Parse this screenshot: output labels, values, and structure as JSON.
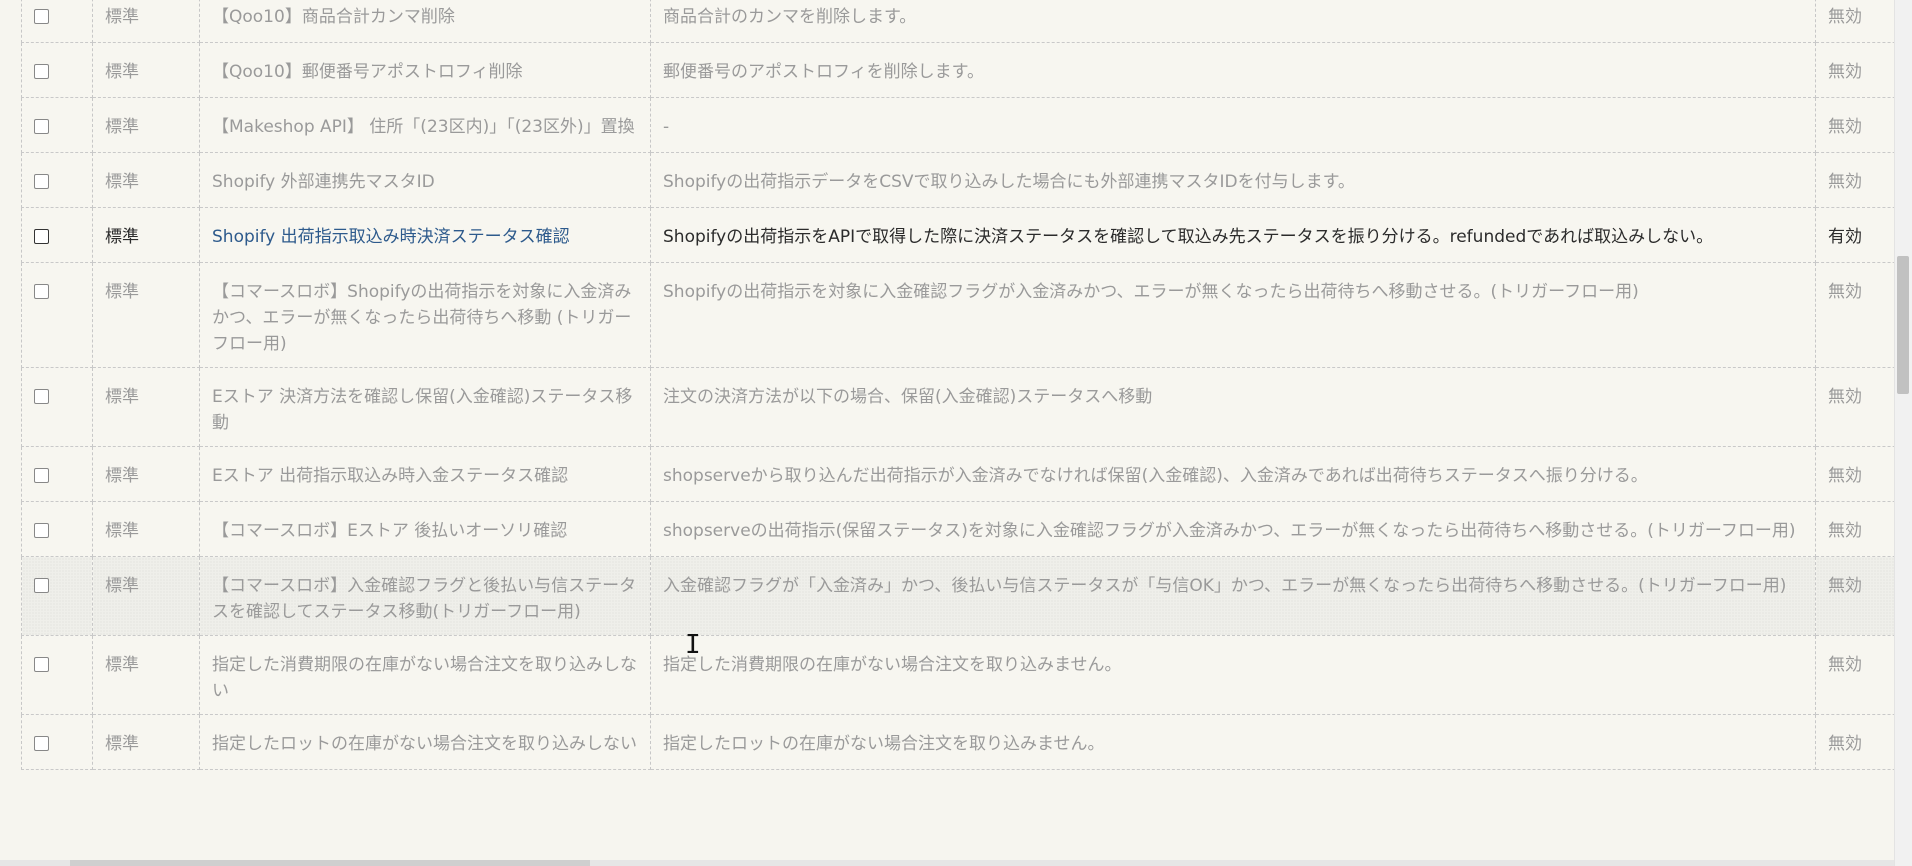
{
  "table": {
    "rows": [
      {
        "type": "標準",
        "name": "【Qoo10】商品合計カンマ削除",
        "description": "商品合計のカンマを削除します。",
        "status": "無効",
        "enabled": false
      },
      {
        "type": "標準",
        "name": "【Qoo10】郵便番号アポストロフィ削除",
        "description": "郵便番号のアポストロフィを削除します。",
        "status": "無効",
        "enabled": false
      },
      {
        "type": "標準",
        "name": "【Makeshop API】 住所「(23区内)」「(23区外)」置換",
        "description": "-",
        "status": "無効",
        "enabled": false
      },
      {
        "type": "標準",
        "name": "Shopify 外部連携先マスタID",
        "description": "Shopifyの出荷指示データをCSVで取り込みした場合にも外部連携マスタIDを付与します。",
        "status": "無効",
        "enabled": false
      },
      {
        "type": "標準",
        "name": "Shopify 出荷指示取込み時決済ステータス確認",
        "description": "Shopifyの出荷指示をAPIで取得した際に決済ステータスを確認して取込み先ステータスを振り分ける。refundedであれば取込みしない。",
        "status": "有効",
        "enabled": true
      },
      {
        "type": "標準",
        "name": "【コマースロボ】Shopifyの出荷指示を対象に入金済みかつ、エラーが無くなったら出荷待ちへ移動 (トリガーフロー用)",
        "description": "Shopifyの出荷指示を対象に入金確認フラグが入金済みかつ、エラーが無くなったら出荷待ちへ移動させる。(トリガーフロー用)",
        "status": "無効",
        "enabled": false
      },
      {
        "type": "標準",
        "name": "Eストア 決済方法を確認し保留(入金確認)ステータス移動",
        "description": "注文の決済方法が以下の場合、保留(入金確認)ステータスへ移動",
        "status": "無効",
        "enabled": false
      },
      {
        "type": "標準",
        "name": "Eストア 出荷指示取込み時入金ステータス確認",
        "description": "shopserveから取り込んだ出荷指示が入金済みでなければ保留(入金確認)、入金済みであれば出荷待ちステータスへ振り分ける。",
        "status": "無効",
        "enabled": false
      },
      {
        "type": "標準",
        "name": "【コマースロボ】Eストア 後払いオーソリ確認",
        "description": "shopserveの出荷指示(保留ステータス)を対象に入金確認フラグが入金済みかつ、エラーが無くなったら出荷待ちへ移動させる。(トリガーフロー用)",
        "status": "無効",
        "enabled": false
      },
      {
        "type": "標準",
        "name": "【コマースロボ】入金確認フラグと後払い与信ステータスを確認してステータス移動(トリガーフロー用)",
        "description": "入金確認フラグが「入金済み」かつ、後払い与信ステータスが「与信OK」かつ、エラーが無くなったら出荷待ちへ移動させる。(トリガーフロー用)",
        "status": "無効",
        "enabled": false,
        "hover": true
      },
      {
        "type": "標準",
        "name": "指定した消費期限の在庫がない場合注文を取り込みしない",
        "description": "指定した消費期限の在庫がない場合注文を取り込みません。",
        "status": "無効",
        "enabled": false
      },
      {
        "type": "標準",
        "name": "指定したロットの在庫がない場合注文を取り込みしない",
        "description": "指定したロットの在庫がない場合注文を取り込みません。",
        "status": "無効",
        "enabled": false
      }
    ]
  },
  "cursor": {
    "glyph": "I"
  }
}
